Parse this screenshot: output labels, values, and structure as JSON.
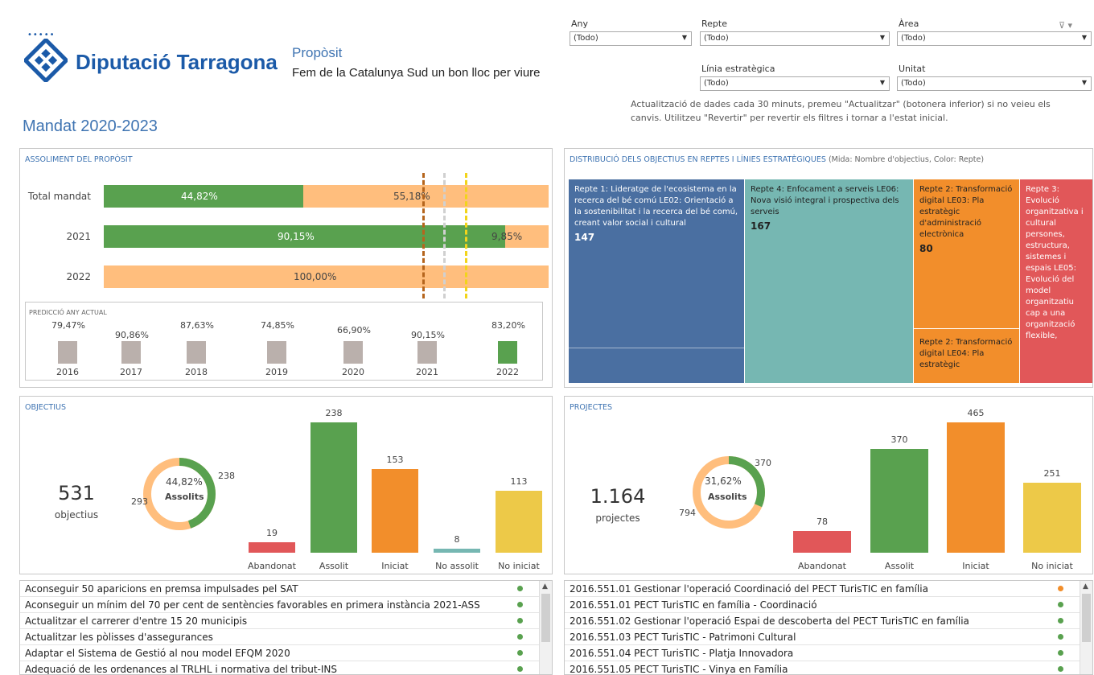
{
  "header": {
    "logo_dots": "•••••",
    "logo_text": "Diputació Tarragona",
    "purpose_title": "Propòsit",
    "purpose_text": "Fem de la Catalunya Sud un bon lloc per viure",
    "mandate": "Mandat 2020-2023"
  },
  "filters": {
    "any": {
      "label": "Any",
      "value": "(Todo)"
    },
    "repte": {
      "label": "Repte",
      "value": "(Todo)"
    },
    "area": {
      "label": "Àrea",
      "value": "(Todo)"
    },
    "linia": {
      "label": "Línia estratègica",
      "value": "(Todo)"
    },
    "unitat": {
      "label": "Unitat",
      "value": "(Todo)"
    },
    "note": "Actualització de dades cada 30 minuts, premeu \"Actualitzar\" (botonera inferior) si no veieu els canvis. Utilitzeu \"Revertir\" per revertir els filtres i tornar a l'estat inicial."
  },
  "assoliment": {
    "title": "ASSOLIMENT DEL PROPÒSIT",
    "rows": [
      {
        "label": "Total mandat",
        "green": 44.82,
        "orange": 55.18,
        "green_text": "44,82%",
        "orange_text": "55,18%"
      },
      {
        "label": "2021",
        "green": 90.15,
        "orange": 9.85,
        "green_text": "90,15%",
        "orange_text": "9,85%"
      },
      {
        "label": "2022",
        "green": 0,
        "orange": 100,
        "green_text": "",
        "orange_text": "100,00%"
      }
    ],
    "prediction": {
      "title": "PREDICCIÓ ANY ACTUAL",
      "items": [
        {
          "year": "2016",
          "value": 79.47,
          "text": "79,47%"
        },
        {
          "year": "2017",
          "value": 90.86,
          "text": "90,86%"
        },
        {
          "year": "2018",
          "value": 87.63,
          "text": "87,63%"
        },
        {
          "year": "2019",
          "value": 74.85,
          "text": "74,85%"
        },
        {
          "year": "2020",
          "value": 66.9,
          "text": "66,90%"
        },
        {
          "year": "2021",
          "value": 90.15,
          "text": "90,15%"
        },
        {
          "year": "2022",
          "value": 83.2,
          "text": "83,20%"
        }
      ]
    }
  },
  "treemap": {
    "title": "DISTRIBUCIÓ DELS OBJECTIUS EN REPTES I LÍNIES ESTRATÈGIQUES",
    "subtitle": "(Mida: Nombre d'objectius, Color: Repte)",
    "cells": [
      {
        "text": "Repte 1: Lideratge de l'ecosistema en la recerca del bé comú LE02: Orientació a la sostenibilitat i la recerca del bé comú, creant valor social i cultural",
        "num": "147"
      },
      {
        "text": "Repte 4: Enfocament a serveis LE06: Nova visió integral i prospectiva dels serveis",
        "num": "167"
      },
      {
        "text": "Repte 2: Transformació digital LE03: Pla estratègic d'administració electrònica",
        "num": "80"
      },
      {
        "text": "Repte 2: Transformació digital LE04: Pla estratègic",
        "num": ""
      },
      {
        "text": "Repte 3: Evolució organitzativa i cultural persones, estructura, sistemes i espais LE05: Evolució del model organitzatiu cap a una organització flexible,",
        "num": ""
      }
    ],
    "colors": {
      "repte1": "#4a6fa1",
      "repte4": "#76b7b2",
      "repte2": "#f28e2b",
      "repte3": "#e15759"
    }
  },
  "objectius": {
    "title": "OBJECTIUS",
    "total": "531",
    "total_label": "objectius",
    "donut_pct": "44,82%",
    "donut_label": "Assolits",
    "donut_fraction": 0.4482,
    "donut_left": "293",
    "donut_right": "238",
    "bars": [
      {
        "cat": "Abandonat",
        "value": 19,
        "color": "#e15759"
      },
      {
        "cat": "Assolit",
        "value": 238,
        "color": "#59a14f"
      },
      {
        "cat": "Iniciat",
        "value": 153,
        "color": "#f28e2b"
      },
      {
        "cat": "No assolit",
        "value": 8,
        "color": "#76b7b2"
      },
      {
        "cat": "No iniciat",
        "value": 113,
        "color": "#edc948"
      }
    ]
  },
  "projectes": {
    "title": "PROJECTES",
    "total": "1.164",
    "total_label": "projectes",
    "donut_pct": "31,62%",
    "donut_label": "Assolits",
    "donut_fraction": 0.3162,
    "donut_left": "794",
    "donut_right": "370",
    "bars": [
      {
        "cat": "Abandonat",
        "value": 78,
        "color": "#e15759"
      },
      {
        "cat": "Assolit",
        "value": 370,
        "color": "#59a14f"
      },
      {
        "cat": "Iniciat",
        "value": 465,
        "color": "#f28e2b"
      },
      {
        "cat": "No iniciat",
        "value": 251,
        "color": "#edc948"
      }
    ]
  },
  "objectius_list": [
    {
      "text": "Aconseguir 50 aparicions en premsa impulsades pel SAT",
      "color": "#59a14f"
    },
    {
      "text": "Aconseguir un mínim del 70 per cent de sentències favorables en primera instància 2021-ASS",
      "color": "#59a14f"
    },
    {
      "text": "Actualitzar el carrerer d'entre 15 20 municipis",
      "color": "#59a14f"
    },
    {
      "text": "Actualitzar les pòlisses d'assegurances",
      "color": "#59a14f"
    },
    {
      "text": "Adaptar el Sistema de Gestió al nou model EFQM 2020",
      "color": "#59a14f"
    },
    {
      "text": "Adequació de les ordenances al TRLHL i normativa del tribut-INS",
      "color": "#59a14f"
    }
  ],
  "projectes_list": [
    {
      "text": "2016.551.01 Gestionar l'operació Coordinació del PECT TurisTIC en família",
      "color": "#f28e2b"
    },
    {
      "text": "2016.551.01 PECT TurisTIC en família - Coordinació",
      "color": "#59a14f"
    },
    {
      "text": "2016.551.02 Gestionar l'operació Espai de descoberta del PECT TurisTIC en família",
      "color": "#59a14f"
    },
    {
      "text": "2016.551.03 PECT TurisTIC - Patrimoni Cultural",
      "color": "#59a14f"
    },
    {
      "text": "2016.551.04 PECT TurisTIC - Platja Innovadora",
      "color": "#59a14f"
    },
    {
      "text": "2016.551.05 PECT TurisTIC - Vinya en Família",
      "color": "#59a14f"
    }
  ]
}
